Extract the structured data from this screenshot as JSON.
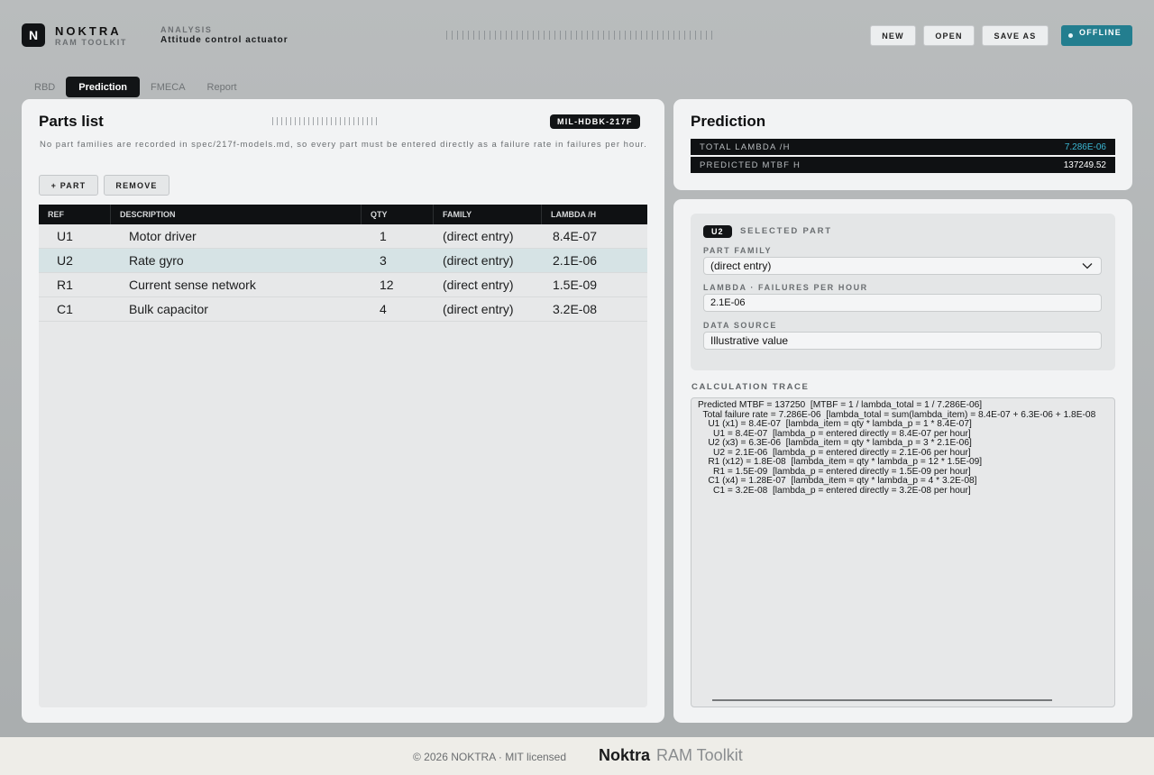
{
  "app": {
    "logo_letter": "N",
    "name": "NOKTRA",
    "subtitle": "RAM TOOLKIT",
    "section_kicker": "ANALYSIS",
    "section_title": "Attitude control actuator"
  },
  "header_actions": {
    "new_label": "NEW",
    "open_label": "OPEN",
    "save_as_label": "SAVE AS",
    "status_label": "OFFLINE",
    "status_color": "#237e8f"
  },
  "tabs": [
    {
      "label": "RBD",
      "active": false
    },
    {
      "label": "Prediction",
      "active": true
    },
    {
      "label": "FMECA",
      "active": false
    },
    {
      "label": "Report",
      "active": false
    }
  ],
  "parts_panel": {
    "title": "Parts list",
    "standard": "MIL-HDBK-217F",
    "note": "No part families are recorded in spec/217f-models.md, so every part must be entered directly as a failure rate in failures per hour.",
    "add_label": "+ PART",
    "remove_label": "REMOVE",
    "columns": [
      "REF",
      "DESCRIPTION",
      "QTY",
      "FAMILY",
      "LAMBDA /H"
    ],
    "rows": [
      {
        "ref": "U1",
        "description": "Motor driver",
        "qty": "1",
        "family": "(direct entry)",
        "lambda": "8.4E-07",
        "selected": false
      },
      {
        "ref": "U2",
        "description": "Rate gyro",
        "qty": "3",
        "family": "(direct entry)",
        "lambda": "2.1E-06",
        "selected": true
      },
      {
        "ref": "R1",
        "description": "Current sense network",
        "qty": "12",
        "family": "(direct entry)",
        "lambda": "1.5E-09",
        "selected": false
      },
      {
        "ref": "C1",
        "description": "Bulk capacitor",
        "qty": "4",
        "family": "(direct entry)",
        "lambda": "3.2E-08",
        "selected": false
      }
    ]
  },
  "prediction": {
    "title": "Prediction",
    "total_lambda_label": "TOTAL LAMBDA  /H",
    "total_lambda_value": "7.286E-06",
    "total_lambda_color": "#3bb8d4",
    "mtbf_label": "PREDICTED MTBF  H",
    "mtbf_value": "137249.52"
  },
  "selected_part": {
    "ref": "U2",
    "kicker": "SELECTED PART",
    "family_label": "PART FAMILY",
    "family_value": "(direct entry)",
    "lambda_label": "LAMBDA · FAILURES PER HOUR",
    "lambda_value": "2.1E-06",
    "source_label": "DATA SOURCE",
    "source_value": "Illustrative value"
  },
  "trace": {
    "label": "CALCULATION TRACE",
    "lines": [
      "Predicted MTBF = 137250  [MTBF = 1 / lambda_total = 1 / 7.286E-06]",
      "  Total failure rate = 7.286E-06  [lambda_total = sum(lambda_item) = 8.4E-07 + 6.3E-06 + 1.8E-08",
      "    U1 (x1) = 8.4E-07  [lambda_item = qty * lambda_p = 1 * 8.4E-07]",
      "      U1 = 8.4E-07  [lambda_p = entered directly = 8.4E-07 per hour]",
      "    U2 (x3) = 6.3E-06  [lambda_item = qty * lambda_p = 3 * 2.1E-06]",
      "      U2 = 2.1E-06  [lambda_p = entered directly = 2.1E-06 per hour]",
      "    R1 (x12) = 1.8E-08  [lambda_item = qty * lambda_p = 12 * 1.5E-09]",
      "      R1 = 1.5E-09  [lambda_p = entered directly = 1.5E-09 per hour]",
      "    C1 (x4) = 1.28E-07  [lambda_item = qty * lambda_p = 4 * 3.2E-08]",
      "      C1 = 3.2E-08  [lambda_p = entered directly = 3.2E-08 per hour]"
    ]
  },
  "footer": {
    "copyright": "© 2026 NOKTRA  ·  MIT licensed",
    "brand": "Noktra",
    "product": "RAM Toolkit"
  }
}
